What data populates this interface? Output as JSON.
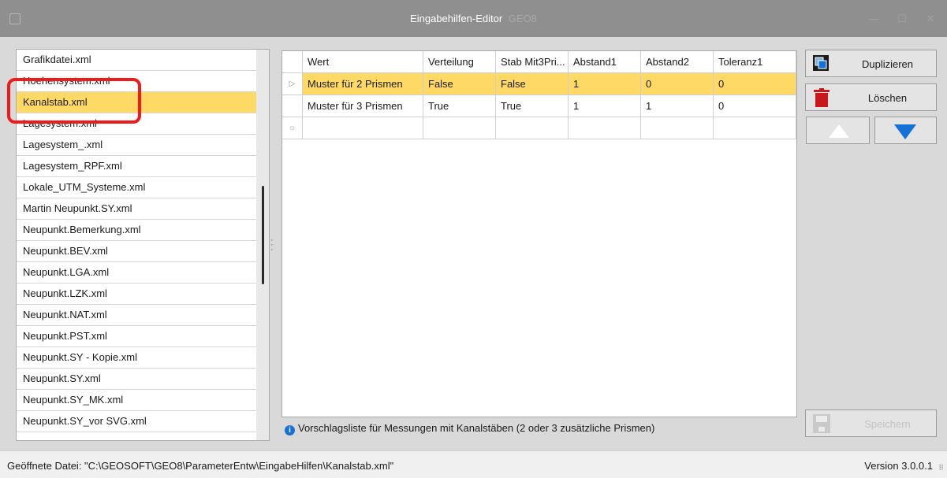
{
  "window": {
    "title": "Eingabehilfen-Editor",
    "title_suffix": "GEO8",
    "controls": {
      "minimize": "—",
      "maximize": "☐",
      "close": "✕"
    }
  },
  "file_list": {
    "items": [
      {
        "label": "Grafikdatei.xml",
        "selected": false
      },
      {
        "label": "Hoehensystem.xml",
        "selected": false
      },
      {
        "label": "Kanalstab.xml",
        "selected": true
      },
      {
        "label": "Lagesystem.xml",
        "selected": false
      },
      {
        "label": "Lagesystem_.xml",
        "selected": false
      },
      {
        "label": "Lagesystem_RPF.xml",
        "selected": false
      },
      {
        "label": "Lokale_UTM_Systeme.xml",
        "selected": false
      },
      {
        "label": "Martin Neupunkt.SY.xml",
        "selected": false
      },
      {
        "label": "Neupunkt.Bemerkung.xml",
        "selected": false
      },
      {
        "label": "Neupunkt.BEV.xml",
        "selected": false
      },
      {
        "label": "Neupunkt.LGA.xml",
        "selected": false
      },
      {
        "label": "Neupunkt.LZK.xml",
        "selected": false
      },
      {
        "label": "Neupunkt.NAT.xml",
        "selected": false
      },
      {
        "label": "Neupunkt.PST.xml",
        "selected": false
      },
      {
        "label": "Neupunkt.SY - Kopie.xml",
        "selected": false
      },
      {
        "label": "Neupunkt.SY.xml",
        "selected": false
      },
      {
        "label": "Neupunkt.SY_MK.xml",
        "selected": false
      },
      {
        "label": "Neupunkt.SY_vor SVG.xml",
        "selected": false
      }
    ]
  },
  "grid": {
    "columns": [
      "Wert",
      "Verteilung",
      "Stab Mit3Pri...",
      "Abstand1",
      "Abstand2",
      "Toleranz1"
    ],
    "rows": [
      {
        "selected": true,
        "cells": [
          "Muster für 2 Prismen",
          "False",
          "False",
          "1",
          "0",
          "0"
        ]
      },
      {
        "selected": false,
        "cells": [
          "Muster für 3 Prismen",
          "True",
          "True",
          "1",
          "1",
          "0"
        ]
      }
    ],
    "current_row_icon": "▷",
    "new_row_icon": "☼"
  },
  "info": {
    "icon": "i",
    "text": "Vorschlagsliste für Messungen mit Kanalstäben (2 oder 3 zusätzliche Prismen)"
  },
  "buttons": {
    "duplicate": "Duplizieren",
    "delete": "Löschen",
    "save": "Speichern"
  },
  "status": {
    "open_file": "Geöffnete Datei: \"C:\\GEOSOFT\\GEO8\\ParameterEntw\\EingabeHilfen\\Kanalstab.xml\"",
    "version": "Version 3.0.0.1",
    "grip": "⠿"
  },
  "colors": {
    "selection": "#ffd966",
    "accent_blue": "#1671d6",
    "delete_red": "#c8181e",
    "highlight_red": "#ee1b1b"
  }
}
